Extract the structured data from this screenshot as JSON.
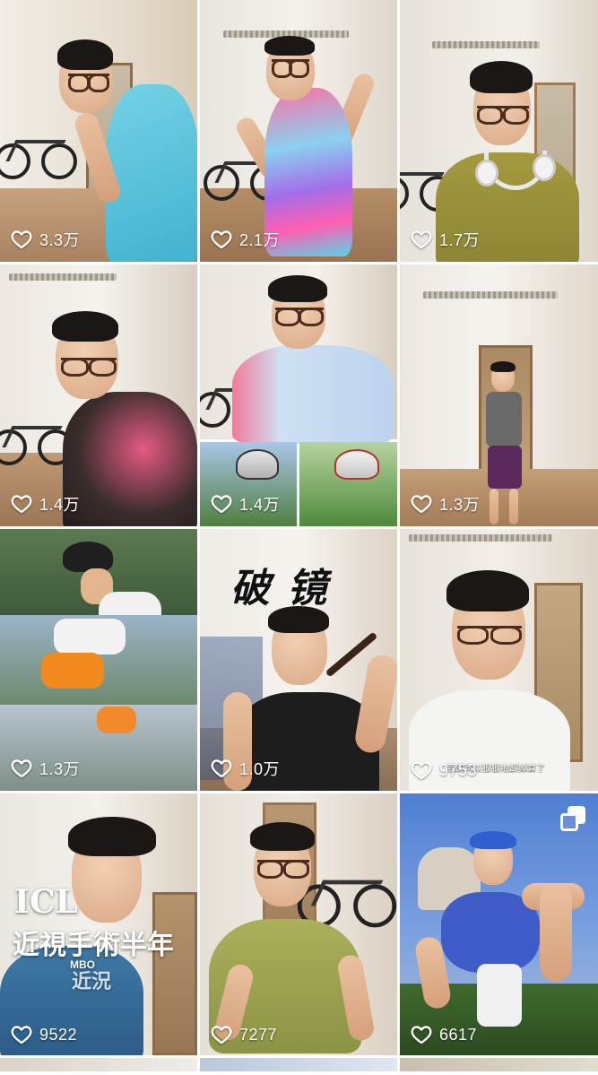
{
  "accent_colors": {
    "like_text": "#ffffff",
    "background": "#ffffff"
  },
  "icons": {
    "like": "heart-outline-icon",
    "multi_image": "multiple-images-icon"
  },
  "videos": [
    {
      "likes": "3.3万"
    },
    {
      "likes": "2.1万"
    },
    {
      "likes": "1.7万"
    },
    {
      "likes": "1.4万"
    },
    {
      "likes": "1.4万"
    },
    {
      "likes": "1.3万"
    },
    {
      "likes": "1.3万"
    },
    {
      "likes": "1.0万",
      "overlay_title": "破  镜"
    },
    {
      "likes": "9753",
      "subtitle": "我的可以狠狠地卸掉算了"
    },
    {
      "likes": "9522",
      "overlay_lines": [
        "ICL",
        "近視手術半年",
        "近況"
      ],
      "shirt_text": "MBO"
    },
    {
      "likes": "7277"
    },
    {
      "likes": "6617"
    }
  ]
}
